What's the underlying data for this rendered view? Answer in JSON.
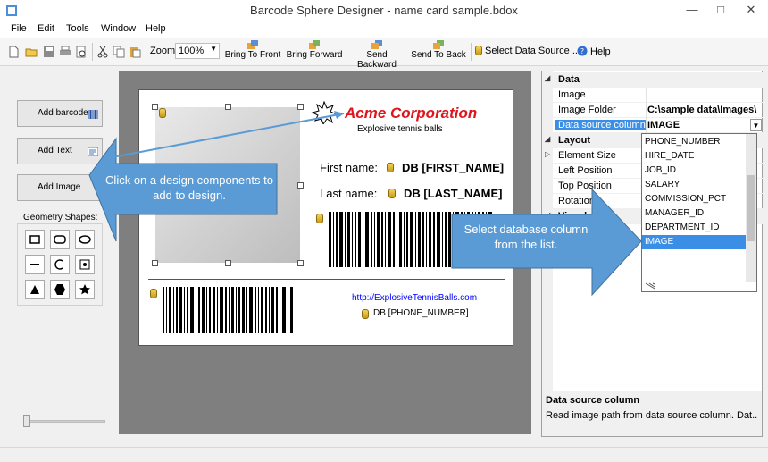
{
  "window": {
    "title": "Barcode Sphere Designer - name card sample.bdox"
  },
  "menu": [
    "File",
    "Edit",
    "Tools",
    "Window",
    "Help"
  ],
  "toolbar": {
    "zoom_label": "Zoom",
    "zoom_value": "100%",
    "bring_to_front": "Bring To Front",
    "bring_forward": "Bring Forward",
    "send_backward": "Send Backward",
    "send_to_back": "Send To Back",
    "select_data_source": "Select Data Source ...",
    "help": "Help"
  },
  "left": {
    "add_barcode": "Add barcode",
    "add_text": "Add Text",
    "add_image": "Add Image",
    "geometry_label": "Geometry Shapes:"
  },
  "card": {
    "company": "Acme Corporation",
    "tagline": "Explosive tennis balls",
    "first_name_label": "First name:",
    "first_name_field": "DB [FIRST_NAME]",
    "last_name_label": "Last name:",
    "last_name_field": "DB [LAST_NAME]",
    "url": "http://ExplosiveTennisBalls.com",
    "phone_field": "DB [PHONE_NUMBER]"
  },
  "properties": {
    "cat_data": "Data",
    "image": "Image",
    "image_folder": "Image Folder",
    "image_folder_value": "C:\\sample data\\Images\\",
    "data_source_column": "Data source column",
    "data_source_column_value": "IMAGE",
    "cat_layout": "Layout",
    "element_size": "Element Size",
    "left_position": "Left Position",
    "top_position": "Top Position",
    "rotation": "Rotation",
    "cat_visual": "Visual"
  },
  "dropdown": [
    "PHONE_NUMBER",
    "HIRE_DATE",
    "JOB_ID",
    "SALARY",
    "COMMISSION_PCT",
    "MANAGER_ID",
    "DEPARTMENT_ID",
    "IMAGE"
  ],
  "help": {
    "title": "Data source column",
    "desc": "Read image path from data source column. Dat..."
  },
  "callouts": {
    "left": "Click on a design components to add to design.",
    "right": "Select database column from the list."
  },
  "colors": {
    "callout": "#5b9bd5",
    "selection": "#3a8ee6",
    "company": "#e0141a"
  }
}
